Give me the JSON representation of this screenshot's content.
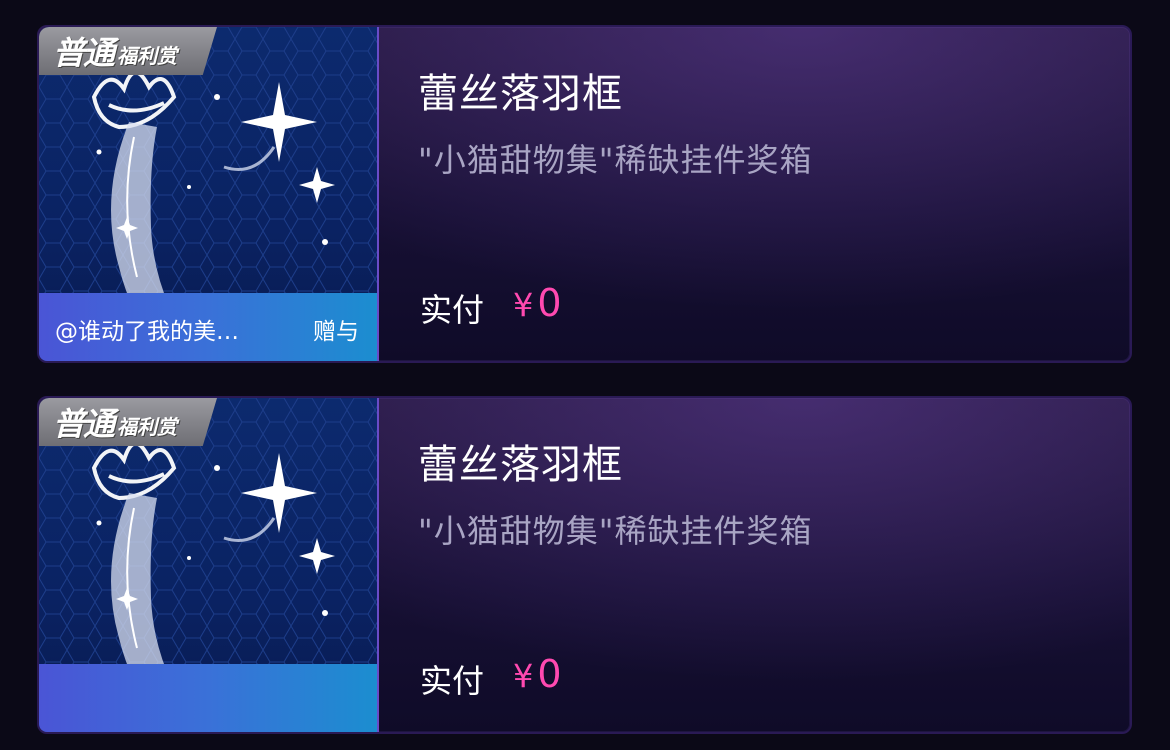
{
  "items": [
    {
      "badge_main": "普通",
      "badge_sub": "福利赏",
      "gift_user": "@谁动了我的美…",
      "gift_action": "赠与",
      "title": "蕾丝落羽框",
      "subtitle": "\"小猫甜物集\"稀缺挂件奖箱",
      "pay_label": "实付",
      "currency": "¥",
      "price": "0"
    },
    {
      "badge_main": "普通",
      "badge_sub": "福利赏",
      "gift_user": "",
      "gift_action": "",
      "title": "蕾丝落羽框",
      "subtitle": "\"小猫甜物集\"稀缺挂件奖箱",
      "pay_label": "实付",
      "currency": "¥",
      "price": "0"
    }
  ],
  "colors": {
    "price": "#ff49b0",
    "badge": "#8a8a90",
    "gift_bar_start": "#4a55d6",
    "gift_bar_end": "#1b8ed0",
    "card_bg": "#171034"
  }
}
